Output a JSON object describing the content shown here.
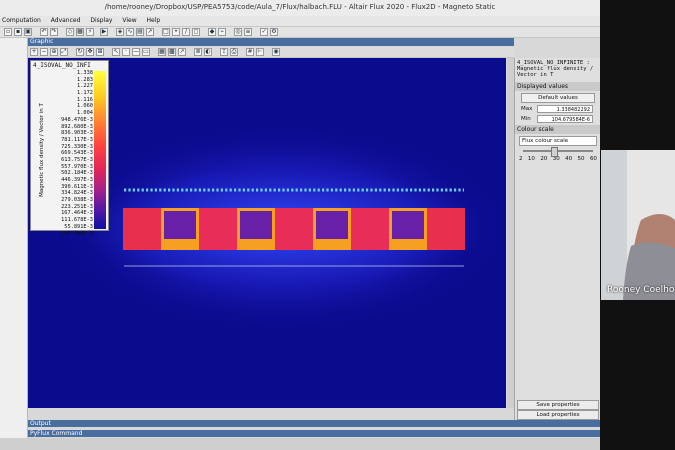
{
  "window": {
    "title": "/home/rooney/Dropbox/USP/PEA5753/code/Aula_7/Flux/halbach.FLU - Altair Flux 2020 - Flux2D - Magneto Static"
  },
  "menu": [
    "Computation",
    "Advanced",
    "Display",
    "View",
    "Help"
  ],
  "panels": {
    "graphic": "Graphic",
    "output": "Output",
    "pyflux": "PyFlux Command"
  },
  "legend": {
    "header": "4_ISOVAL_NO_INFI",
    "label": "Magnetic flux density / Vector in T",
    "values": [
      "1.338",
      "1.283",
      "1.227",
      "1.172",
      "1.116",
      "1.060",
      "1.004",
      "948.476E-3",
      "892.680E-3",
      "836.903E-3",
      "781.117E-3",
      "725.330E-3",
      "669.543E-3",
      "613.757E-3",
      "557.970E-3",
      "502.184E-3",
      "446.397E-3",
      "390.611E-3",
      "334.824E-3",
      "279.038E-3",
      "223.251E-3",
      "167.464E-3",
      "111.678E-3",
      "55.891E-3",
      "104.680E-6"
    ]
  },
  "right_panel": {
    "header": "4_ISOVAL_NO_INFINITE : Magnetic flux density / Vector in T",
    "displayed_values_title": "Displayed values",
    "default_button": "Default values",
    "max_label": "Max",
    "max_value": "1.338482292",
    "min_label": "Min",
    "min_value": "104.679584E-6",
    "colour_scale_title": "Colour scale",
    "colour_scale_option": "Flux colour scale",
    "ticks": [
      "2",
      "10",
      "20",
      "30",
      "40",
      "50",
      "60"
    ],
    "save_button": "Save properties",
    "load_button": "Load properties"
  },
  "webcam": {
    "name": "Rooney Coelho"
  },
  "colors": {
    "background_field": "#0b0b8e",
    "title_bar_accent": "#4a6da0"
  }
}
